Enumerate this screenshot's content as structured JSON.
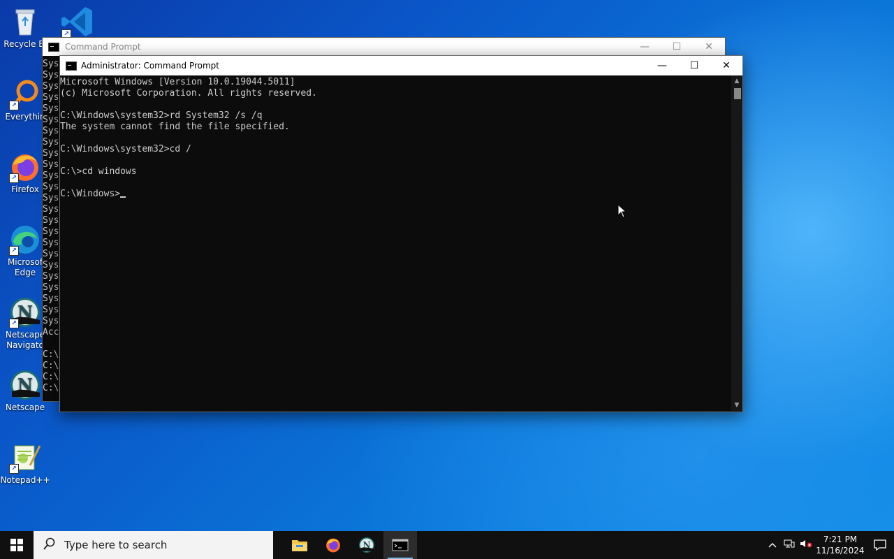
{
  "desktop": {
    "icons": [
      {
        "label": "Recycle Bin",
        "short": "Recycle Bi",
        "icon": "recycle-bin-icon"
      },
      {
        "label": "Everything",
        "short": "Everythin",
        "icon": "everything-icon"
      },
      {
        "label": "Firefox",
        "short": "Firefox",
        "icon": "firefox-icon"
      },
      {
        "label": "Microsoft Edge",
        "short": "Microsof",
        "short2": "Edge",
        "icon": "edge-icon"
      },
      {
        "label": "Netscape Navigator",
        "short": "Netscape",
        "short2": "Navigato",
        "icon": "netscape-icon"
      },
      {
        "label": "Netscape",
        "short": "Netscape",
        "icon": "netscape-icon"
      },
      {
        "label": "Notepad++",
        "short": "Notepad++",
        "icon": "notepadpp-icon"
      }
    ]
  },
  "back_window": {
    "title": "Command Prompt",
    "lines": [
      "Sys",
      "Sys",
      "Sys",
      "Sys",
      "Sys",
      "Sys",
      "Sys",
      "Sys",
      "Sys",
      "Sys",
      "Sys",
      "Sys",
      "Sys",
      "Sys",
      "Sys",
      "Sys",
      "Sys",
      "Sys",
      "Sys",
      "Sys",
      "Sys",
      "Sys",
      "Sys",
      "Sys",
      "Acc",
      "",
      "C:\\",
      "C:\\",
      "C:\\",
      "C:\\"
    ]
  },
  "front_window": {
    "title": "Administrator: Command Prompt",
    "lines": [
      "Microsoft Windows [Version 10.0.19044.5011]",
      "(c) Microsoft Corporation. All rights reserved.",
      "",
      "C:\\Windows\\system32>rd System32 /s /q",
      "The system cannot find the file specified.",
      "",
      "C:\\Windows\\system32>cd /",
      "",
      "C:\\>cd windows",
      "",
      "C:\\Windows>"
    ]
  },
  "window_controls": {
    "minimize": "—",
    "maximize": "☐",
    "close": "✕"
  },
  "taskbar": {
    "search_placeholder": "Type here to search",
    "apps": [
      "file-explorer-icon",
      "firefox-icon",
      "netscape-icon",
      "command-prompt-icon"
    ],
    "active_app": "command-prompt-icon",
    "time": "7:21 PM",
    "date": "11/16/2024"
  },
  "colors": {
    "taskbar": "#101010",
    "console_bg": "#0c0c0c",
    "console_text": "#cccccc",
    "accent": "#76b9ed"
  }
}
